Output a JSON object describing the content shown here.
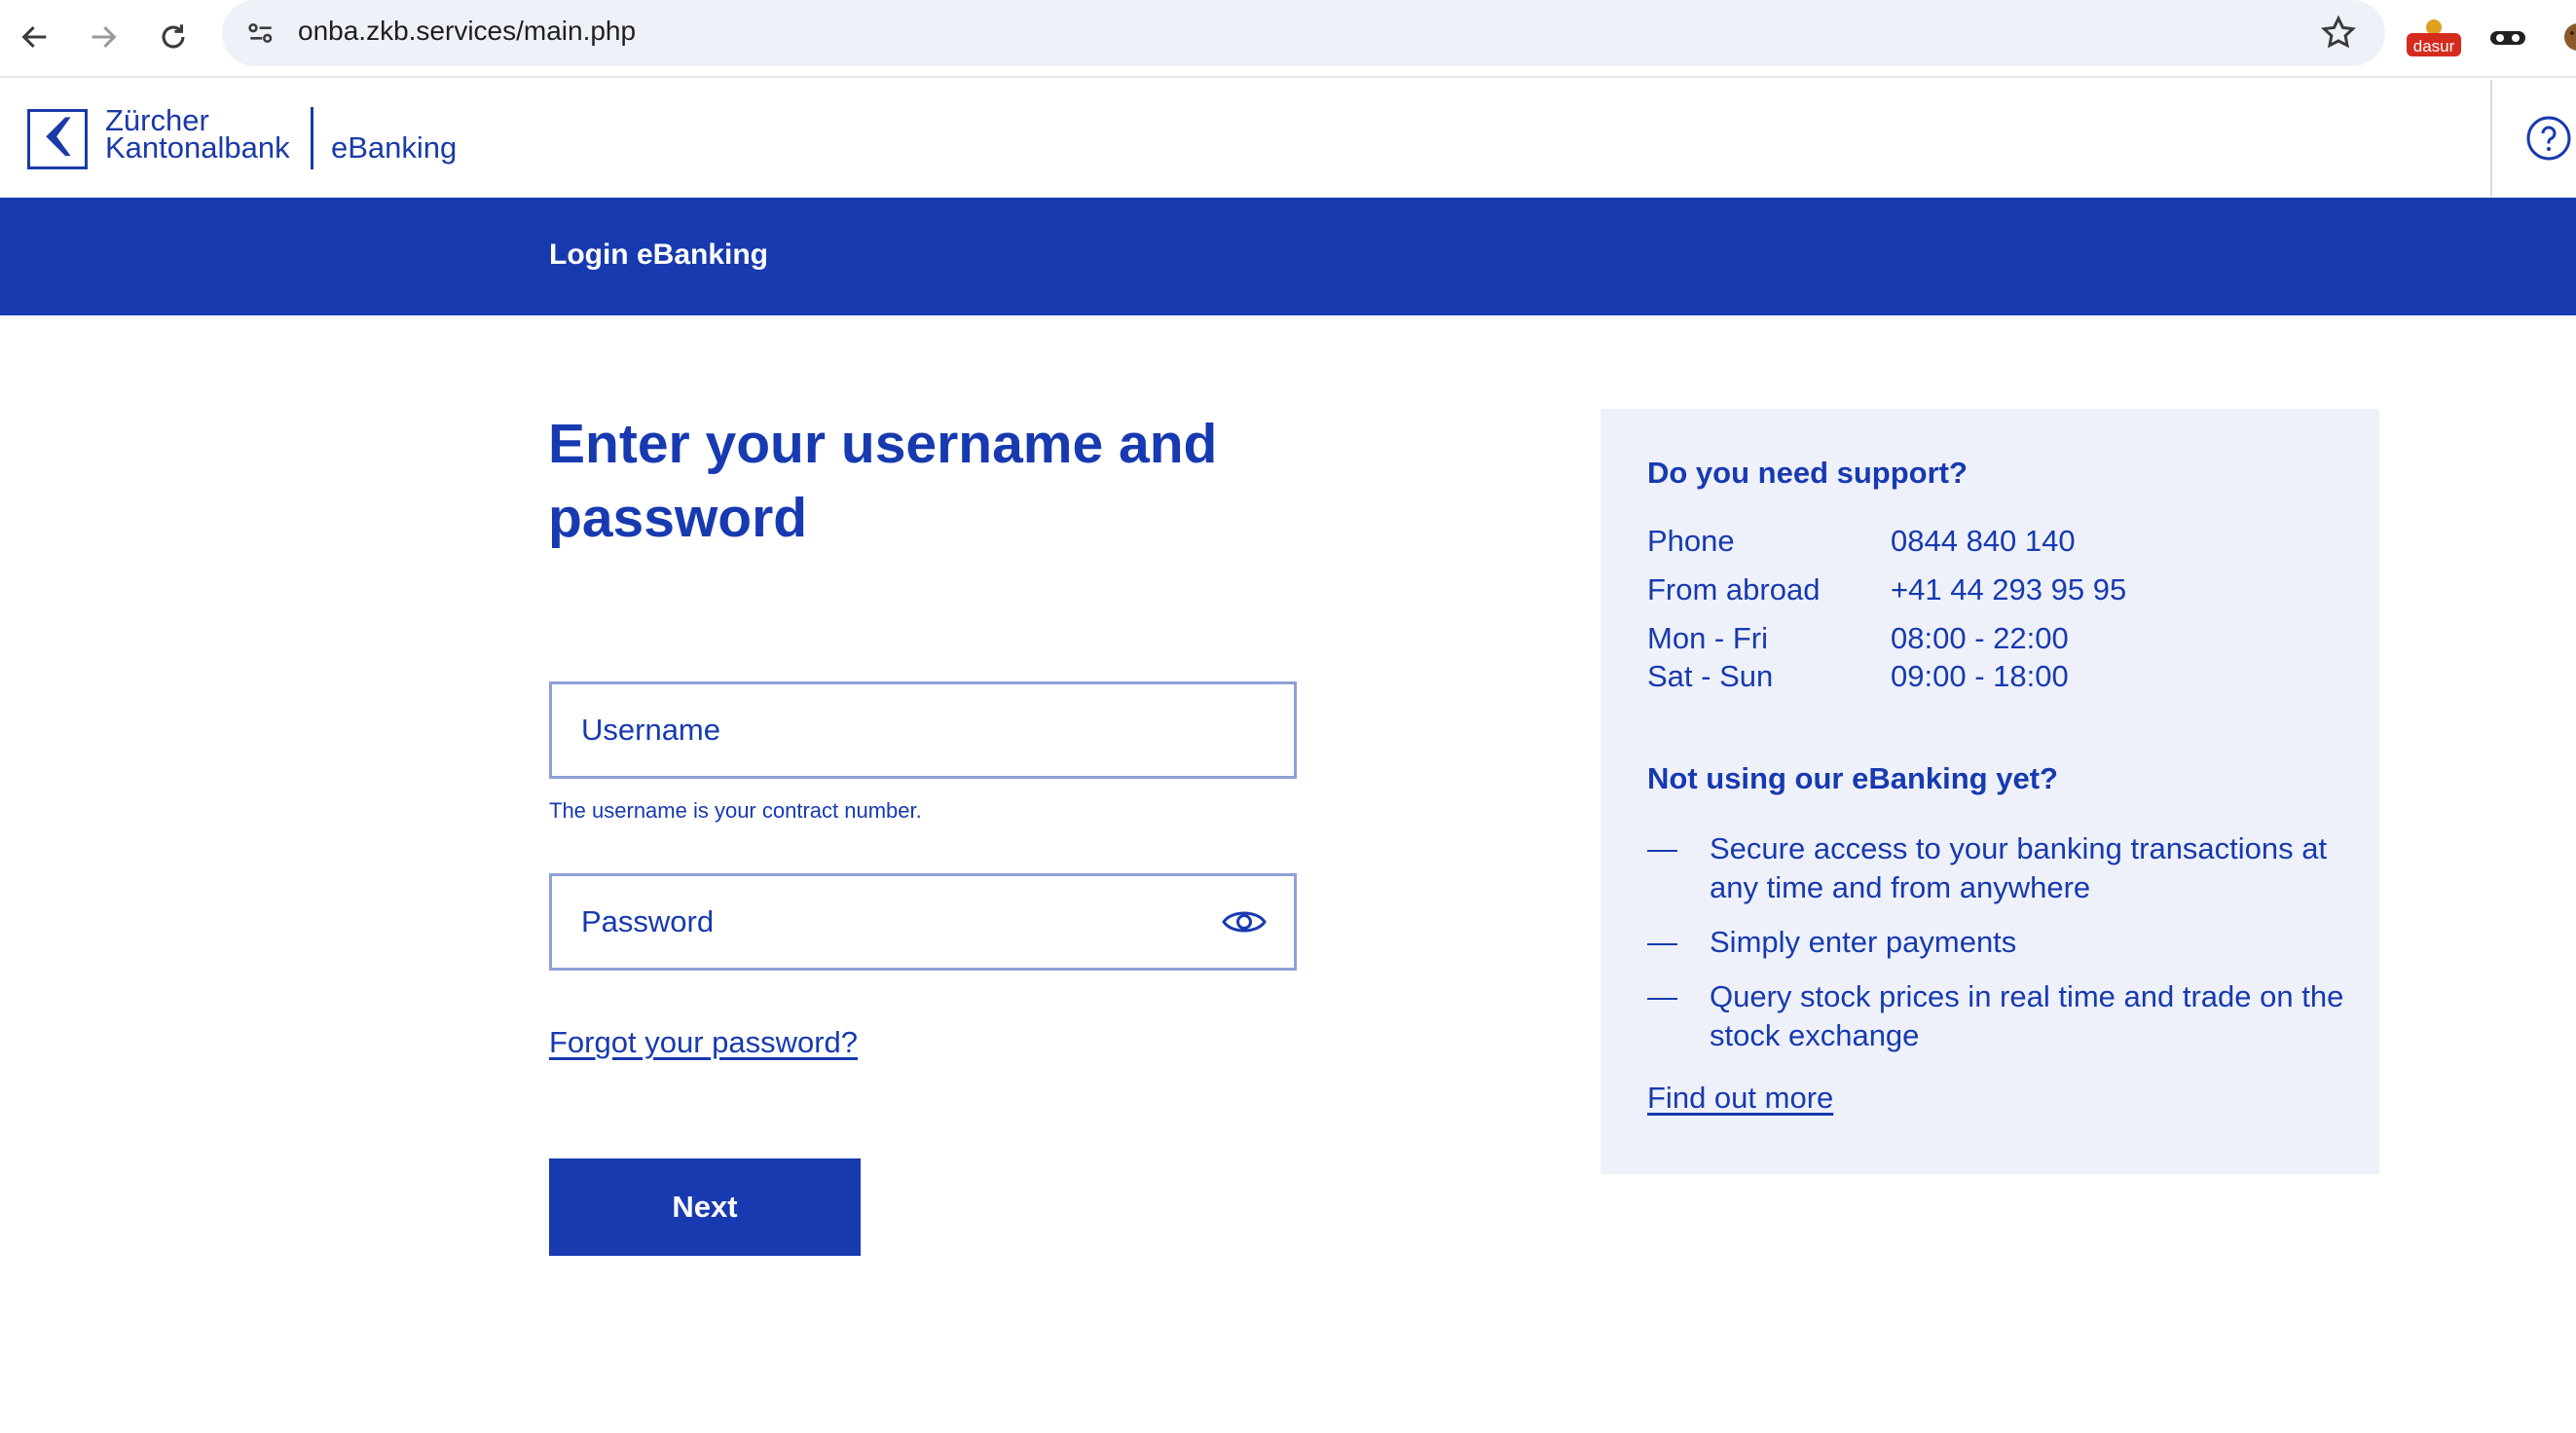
{
  "browser": {
    "url": "onba.zkb.services/main.php",
    "extensions": {
      "dasur_label": "dasur"
    }
  },
  "header": {
    "bank_name_line1": "Zürcher",
    "bank_name_line2": "Kantonalbank",
    "product": "eBanking"
  },
  "band": {
    "title": "Login eBanking"
  },
  "form": {
    "title": "Enter your username and password",
    "username_placeholder": "Username",
    "username_hint": "The username is your contract number.",
    "password_placeholder": "Password",
    "forgot_link": "Forgot your password?",
    "next_label": "Next"
  },
  "support": {
    "heading": "Do you need support?",
    "contacts": [
      {
        "label": "Phone",
        "value": "0844 840 140"
      },
      {
        "label": "From abroad",
        "value": "+41 44 293 95 95"
      },
      {
        "label": "Mon - Fri",
        "value": "08:00 - 22:00"
      },
      {
        "label": "Sat - Sun",
        "value": "09:00 - 18:00"
      }
    ],
    "promo_heading": "Not using our eBanking yet?",
    "bullets": [
      "Secure access to your banking transactions at any time and from anywhere",
      "Simply enter payments",
      "Query stock prices in real time and trade on the stock exchange"
    ],
    "bullet_marker": "—",
    "find_more": "Find out more"
  },
  "colors": {
    "brand": "#173ab0",
    "panel": "#eef1fa",
    "field_border": "#8fa0d8"
  }
}
